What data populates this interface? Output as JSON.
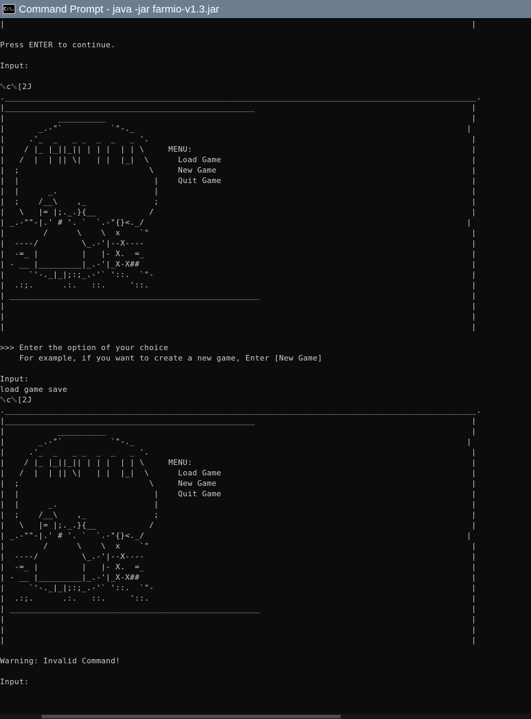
{
  "window": {
    "icon_label": "C:\\.",
    "title": "Command Prompt - java  -jar farmio-v1.3.jar"
  },
  "console": {
    "lines": [
      "|                                                                                                 |",
      "",
      "Press ENTER to continue.",
      "",
      "Input:",
      "",
      "␛c␛[2J",
      ".__________________________________________________________________________________________________.",
      "|____________________________________________________                                             |",
      "|           __________                                                                            |",
      "|       _.-\"`          `\"-._                                                                     |",
      "|     .'_  _   _ _  _  _   _ '.                                                                   |",
      "|    / |_ |_||_|| | | |  | | \\     MENU:                                                          |",
      "|   /  |  | || \\|   | |  |_|  \\      Load Game                                                    |",
      "|  ;                           \\     New Game                                                     |",
      "|  |                            |    Quit Game                                                    |",
      "|  |      _.                    |                                                                 |",
      "|  ;    /__\\    ,_              ;                                                                 |",
      "|   \\   |= |;._.}{__           /                                                                  |",
      "| _.-\"\"-|.' # '. `  `.-\"{}<._/                                                                   |",
      "|        /      \\    \\  x    `\"                                                                   |",
      "|  ----/         \\_.-'|--X----                                                                    |",
      "|  -=_ |         |   |- X.  =_                                                                    |",
      "| - __ |_________|_.-'|_X-X##                                                                     |",
      "|     `'-._|_|;:;_.-'` '::.  `\"-                                                                  |",
      "|  .:;.      .:.   ::.     '::.                                                                   |",
      "| ____________________________________________________                                            |",
      "|                                                                                                 |",
      "|                                                                                                 |",
      "|                                                                                                 |",
      "",
      ">>> Enter the option of your choice",
      "    For example, if you want to create a new game, Enter [New Game]",
      "",
      "Input:",
      "load game save",
      "␛c␛[2J",
      ".__________________________________________________________________________________________________.",
      "|____________________________________________________                                             |",
      "|           __________                                                                            |",
      "|       _.-\"`          `\"-._                                                                     |",
      "|     .'_  _   _ _  _  _   _ '.                                                                   |",
      "|    / |_ |_||_|| | | |  | | \\     MENU:                                                          |",
      "|   /  |  | || \\|   | |  |_|  \\      Load Game                                                    |",
      "|  ;                           \\     New Game                                                     |",
      "|  |                            |    Quit Game                                                    |",
      "|  |      _.                    |                                                                 |",
      "|  ;    /__\\    ,_              ;                                                                 |",
      "|   \\   |= |;._.}{__           /                                                                  |",
      "| _.-\"\"-|.' # '. `  `.-\"{}<._/                                                                   |",
      "|        /      \\    \\  x    `\"                                                                   |",
      "|  ----/         \\_.-'|--X----                                                                    |",
      "|  -=_ |         |   |- X.  =_                                                                    |",
      "| - __ |_________|_.-'|_X-X##                                                                     |",
      "|     `'-._|_|;:;_.-'` '::.  `\"-                                                                  |",
      "|  .:;.      .:.   ::.     '::.                                                                   |",
      "| ____________________________________________________                                            |",
      "|                                                                                                 |",
      "|                                                                                                 |",
      "|                                                                                                 |",
      "",
      "Warning: Invalid Command!",
      "",
      "Input:"
    ]
  }
}
